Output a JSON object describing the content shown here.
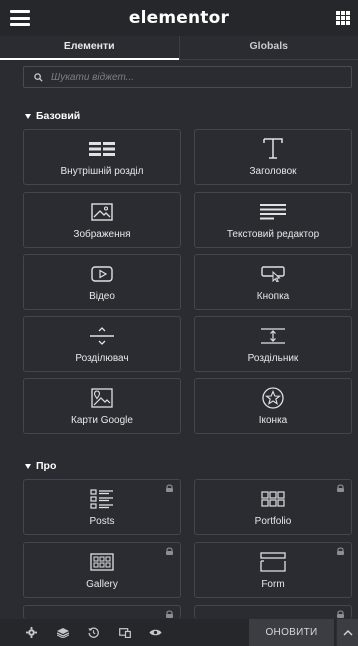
{
  "topbar": {
    "brand": "elementor"
  },
  "tabs": [
    {
      "label": "Елементи"
    },
    {
      "label": "Globals"
    }
  ],
  "search": {
    "placeholder": "Шукати віджет..."
  },
  "sections": [
    {
      "title": "Базовий",
      "widgets": [
        {
          "label": "Внутрішній розділ",
          "icon": "inner-section-icon"
        },
        {
          "label": "Заголовок",
          "icon": "heading-icon"
        },
        {
          "label": "Зображення",
          "icon": "image-icon"
        },
        {
          "label": "Текстовий редактор",
          "icon": "text-editor-icon"
        },
        {
          "label": "Відео",
          "icon": "video-icon"
        },
        {
          "label": "Кнопка",
          "icon": "button-icon"
        },
        {
          "label": "Розділювач",
          "icon": "divider-icon"
        },
        {
          "label": "Роздільник",
          "icon": "spacer-icon"
        },
        {
          "label": "Карти Google",
          "icon": "google-maps-icon"
        },
        {
          "label": "Іконка",
          "icon": "star-icon"
        }
      ]
    },
    {
      "title": "Про",
      "widgets": [
        {
          "label": "Posts",
          "icon": "posts-icon",
          "locked": true
        },
        {
          "label": "Portfolio",
          "icon": "portfolio-icon",
          "locked": true
        },
        {
          "label": "Gallery",
          "icon": "gallery-icon",
          "locked": true
        },
        {
          "label": "Form",
          "icon": "form-icon",
          "locked": true
        }
      ]
    }
  ],
  "bottombar": {
    "icons": [
      "settings-icon",
      "layers-icon",
      "history-icon",
      "responsive-icon",
      "preview-icon"
    ],
    "update_label": "ОНОВИТИ"
  },
  "colors": {
    "background": "#2b2c31",
    "card_border": "#45464c",
    "lock": "#8c8e94"
  }
}
